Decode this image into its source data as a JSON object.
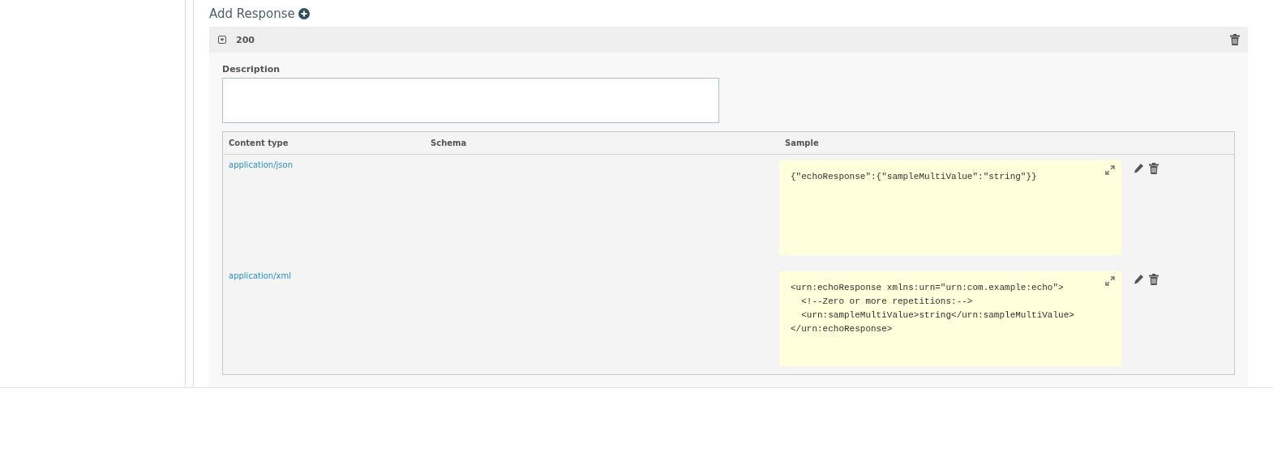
{
  "add_response": {
    "label": "Add Response"
  },
  "responses": [
    {
      "code": "200",
      "expanded": true,
      "description": {
        "label": "Description"
      },
      "table": {
        "columns": [
          "Content type",
          "Schema",
          "Sample"
        ],
        "rows": [
          {
            "content_type": "application/json",
            "sample": "{\"echoResponse\":{\"sampleMultiValue\":\"string\"}}"
          },
          {
            "content_type": "application/xml",
            "sample": "<urn:echoResponse xmlns:urn=\"urn:com.example:echo\">\n  <!--Zero or more repetitions:-->\n  <urn:sampleMultiValue>string</urn:sampleMultiValue>\n</urn:echoResponse>"
          }
        ]
      }
    }
  ]
}
